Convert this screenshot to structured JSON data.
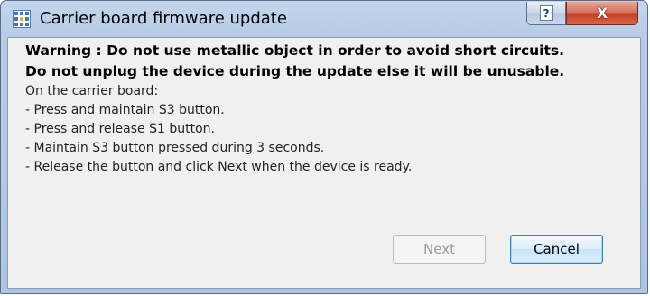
{
  "window": {
    "title": "Carrier board firmware update",
    "app_icon": "grid-app-icon",
    "help_glyph": "?",
    "close_glyph": "X"
  },
  "message": {
    "warning_line_1": "Warning : Do not use metallic object in order to avoid short circuits.",
    "warning_line_2": "Do not unplug the device during the update else it will be unusable.",
    "intro": "On the carrier board:",
    "steps": [
      "- Press and maintain S3 button.",
      "- Press and release S1 button.",
      "- Maintain S3 button pressed during 3 seconds.",
      "- Release the button and click Next when the device is ready."
    ]
  },
  "buttons": {
    "next_label": "Next",
    "next_enabled": false,
    "cancel_label": "Cancel"
  },
  "colors": {
    "title_bar": "#b9cde8",
    "close_button": "#c43d21",
    "cancel_border": "#3c7fb1",
    "dialog_background": "#f0f0f0"
  }
}
